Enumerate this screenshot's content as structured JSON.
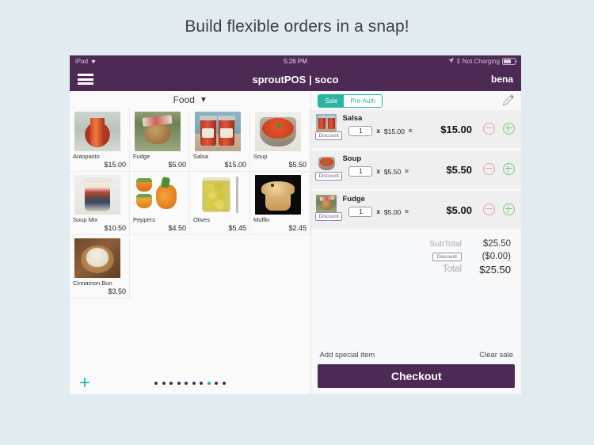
{
  "caption": "Build flexible orders in a snap!",
  "statusbar": {
    "device": "iPad",
    "wifi_icon": "wifi-icon",
    "time": "5:26 PM",
    "location_icon": "location-arrow-icon",
    "bluetooth_icon": "bluetooth-icon",
    "battery_text": "Not Charging",
    "battery_icon": "battery-icon"
  },
  "navbar": {
    "menu_icon": "hamburger-menu-icon",
    "title": "sproutPOS | soco",
    "user": "bena"
  },
  "catalog": {
    "category_label": "Food",
    "caret_icon": "chevron-down-icon",
    "add_icon": "plus-icon",
    "page_dots": 10,
    "active_dot": 8,
    "products": [
      {
        "name": "Antopasto",
        "price": "$15.00",
        "image": "antipasto-jar"
      },
      {
        "name": "Fudge",
        "price": "$5.00",
        "image": "fudge-bag"
      },
      {
        "name": "Salsa",
        "price": "$15.00",
        "image": "salsa-jars"
      },
      {
        "name": "Soup",
        "price": "$5.50",
        "image": "soup-bowl"
      },
      {
        "name": "Soup Mix",
        "price": "$10.50",
        "image": "soup-mix-jar"
      },
      {
        "name": "Peppers",
        "price": "$4.50",
        "image": "orange-peppers"
      },
      {
        "name": "Olives",
        "price": "$5.45",
        "image": "olives-jar"
      },
      {
        "name": "Muffin",
        "price": "$2.45",
        "image": "muffin"
      },
      {
        "name": "Cinnamon Bun",
        "price": "$3.50",
        "image": "cinnamon-bun"
      }
    ]
  },
  "order": {
    "tabs": [
      {
        "label": "Sale",
        "active": true
      },
      {
        "label": "Pre-Auth",
        "active": false
      }
    ],
    "edit_icon": "pencil-icon",
    "discount_label": "Discount",
    "multiply_symbol": "x",
    "equals_symbol": "=",
    "minus_icon": "minus-circle-icon",
    "plus_icon": "plus-circle-icon",
    "items": [
      {
        "name": "Salsa",
        "qty": "1",
        "unit_price": "$15.00",
        "line_total": "$15.00",
        "image": "salsa-jars"
      },
      {
        "name": "Soup",
        "qty": "1",
        "unit_price": "$5.50",
        "line_total": "$5.50",
        "image": "soup-bowl"
      },
      {
        "name": "Fudge",
        "qty": "1",
        "unit_price": "$5.00",
        "line_total": "$5.00",
        "image": "fudge-bag"
      }
    ],
    "totals": {
      "subtotal_label": "SubTotal",
      "subtotal_value": "$25.50",
      "discount_label": "Discount",
      "discount_value": "($0.00)",
      "total_label": "Total",
      "total_value": "$25.50"
    },
    "add_special_item": "Add special item",
    "clear_sale": "Clear sale",
    "checkout": "Checkout"
  },
  "colors": {
    "purple": "#4d2a54",
    "teal": "#2bb5a0",
    "page_bg": "#e2ecf0",
    "panel_bg": "#f7f8f9"
  }
}
